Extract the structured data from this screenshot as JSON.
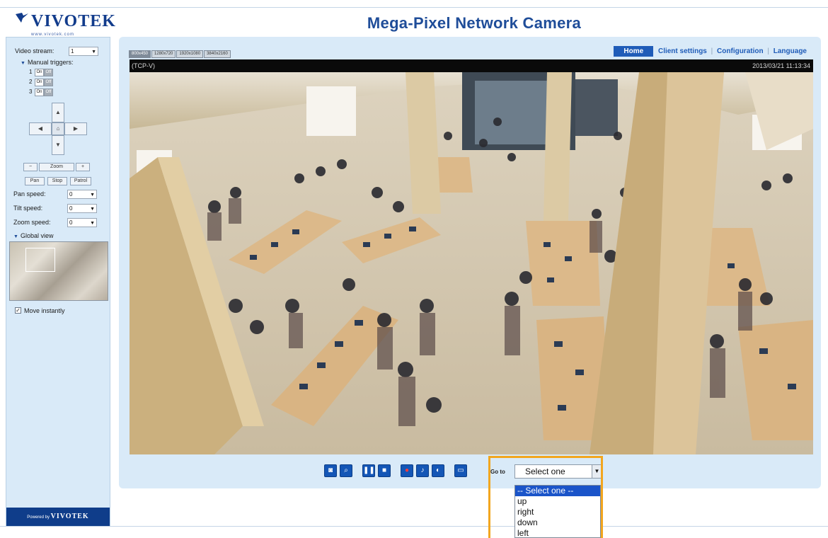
{
  "header": {
    "brand": "VIVOTEK",
    "brand_url": "www.vivotek.com",
    "title": "Mega-Pixel Network Camera"
  },
  "sidebar": {
    "video_stream_label": "Video stream:",
    "video_stream_value": "1",
    "manual_triggers_label": "Manual triggers:",
    "triggers": [
      {
        "num": "1",
        "on": "On",
        "off": "Off"
      },
      {
        "num": "2",
        "on": "On",
        "off": "Off"
      },
      {
        "num": "3",
        "on": "On",
        "off": "Off"
      }
    ],
    "zoom_label": "Zoom",
    "zoom_minus": "−",
    "zoom_plus": "+",
    "pan_btn": "Pan",
    "stop_btn": "Stop",
    "patrol_btn": "Patrol",
    "pan_speed_label": "Pan speed:",
    "pan_speed_value": "0",
    "tilt_speed_label": "Tilt speed:",
    "tilt_speed_value": "0",
    "zoom_speed_label": "Zoom speed:",
    "zoom_speed_value": "0",
    "global_view_label": "Global view",
    "move_instantly_label": "Move instantly",
    "powered_by": "Powered by",
    "powered_brand": "VIVOTEK"
  },
  "main": {
    "size_buttons": [
      "800x450",
      "1280x720",
      "1920x1080",
      "3840x2160"
    ],
    "nav": {
      "home": "Home",
      "client_settings": "Client settings",
      "configuration": "Configuration",
      "language": "Language",
      "separator": "|"
    },
    "video": {
      "protocol": "(TCP-V)",
      "timestamp": "2013/03/21 11:13:34"
    },
    "goto_label": "Go to",
    "goto_value": "Select one"
  },
  "controls": [
    {
      "name": "snapshot-icon",
      "glyph": "◙"
    },
    {
      "name": "digital-zoom-icon",
      "glyph": "⌕"
    },
    {
      "name": "pause-icon",
      "glyph": "❚❚"
    },
    {
      "name": "stop-icon",
      "glyph": "■"
    },
    {
      "name": "record-icon",
      "glyph": "●"
    },
    {
      "name": "volume-icon",
      "glyph": "♪"
    },
    {
      "name": "talk-icon",
      "glyph": "◐"
    },
    {
      "name": "fullscreen-icon",
      "glyph": "▭"
    }
  ],
  "dropdown": {
    "options": [
      "-- Select one --",
      "up",
      "right",
      "down",
      "left"
    ],
    "selected_index": 0
  },
  "colors": {
    "accent": "#1f5cb8",
    "panel_bg": "#d9eaf8",
    "highlight": "#f2a61f",
    "selected": "#1a54c9"
  }
}
